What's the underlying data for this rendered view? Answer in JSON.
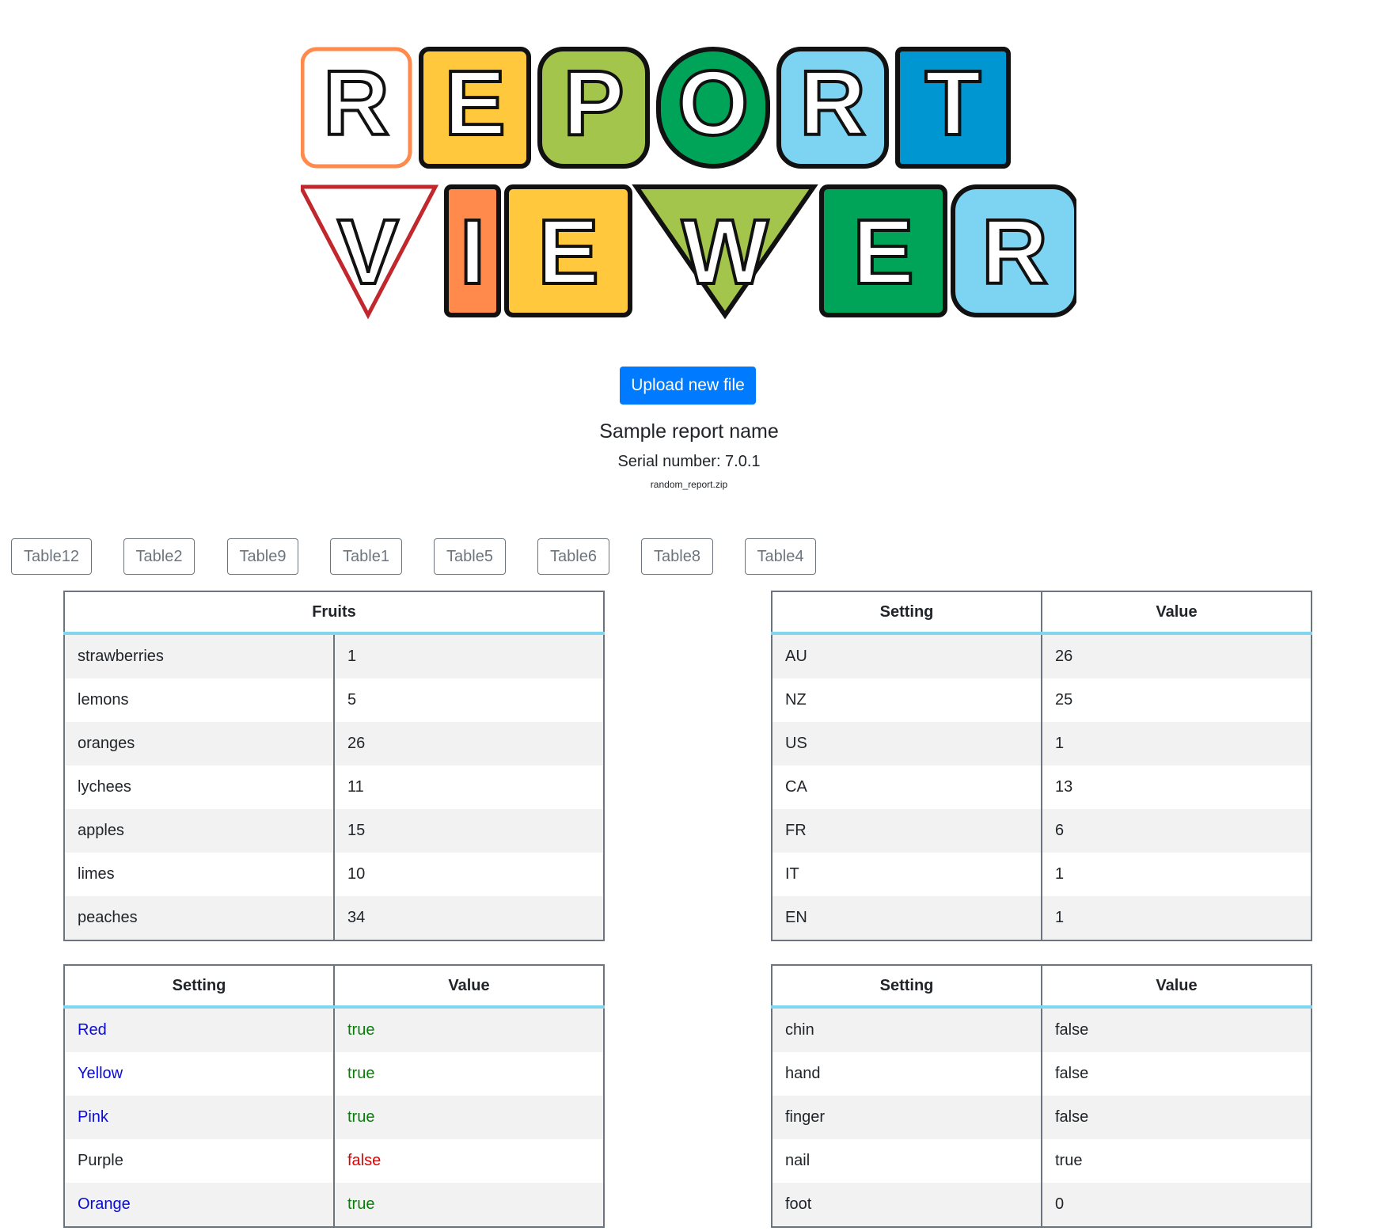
{
  "logo": {
    "line1": "REPORT",
    "line2": "VIEWER",
    "colors_line1": [
      "#ffffff",
      "#ffc83d",
      "#a4c54c",
      "#00a458",
      "#7cd3f2",
      "#0096d1"
    ],
    "colors_line2": [
      "#ffffff",
      "#ff8a4c",
      "#ffc83d",
      "#a4c54c",
      "#00a458",
      "#7cd3f2"
    ]
  },
  "upload_button": "Upload new file",
  "report": {
    "name": "Sample report name",
    "serial": "Serial number: 7.0.1",
    "filename": "random_report.zip"
  },
  "tabs": [
    "Table12",
    "Table2",
    "Table9",
    "Table1",
    "Table5",
    "Table6",
    "Table8",
    "Table4"
  ],
  "accent_colors": {
    "primary": "#007bff",
    "header_underline": "#7fd6ee",
    "link_blue": "#0a0ad6",
    "true_green": "#0b7d0b",
    "false_red": "#e00000"
  },
  "tables": [
    {
      "headers": [
        "Fruits"
      ],
      "rows": [
        [
          "strawberries",
          "1"
        ],
        [
          "lemons",
          "5"
        ],
        [
          "oranges",
          "26"
        ],
        [
          "lychees",
          "11"
        ],
        [
          "apples",
          "15"
        ],
        [
          "limes",
          "10"
        ],
        [
          "peaches",
          "34"
        ]
      ]
    },
    {
      "headers": [
        "Setting",
        "Value"
      ],
      "rows": [
        [
          "AU",
          "26"
        ],
        [
          "NZ",
          "25"
        ],
        [
          "US",
          "1"
        ],
        [
          "CA",
          "13"
        ],
        [
          "FR",
          "6"
        ],
        [
          "IT",
          "1"
        ],
        [
          "EN",
          "1"
        ]
      ]
    },
    {
      "headers": [
        "Setting",
        "Value"
      ],
      "rows": [
        [
          "Red",
          "true"
        ],
        [
          "Yellow",
          "true"
        ],
        [
          "Pink",
          "true"
        ],
        [
          "Purple",
          "false"
        ],
        [
          "Orange",
          "true"
        ]
      ],
      "row_styles": [
        "blue",
        "blue",
        "blue",
        "dark",
        "blue"
      ]
    },
    {
      "headers": [
        "Setting",
        "Value"
      ],
      "rows": [
        [
          "chin",
          "false"
        ],
        [
          "hand",
          "false"
        ],
        [
          "finger",
          "false"
        ],
        [
          "nail",
          "true"
        ],
        [
          "foot",
          "0"
        ]
      ]
    }
  ]
}
